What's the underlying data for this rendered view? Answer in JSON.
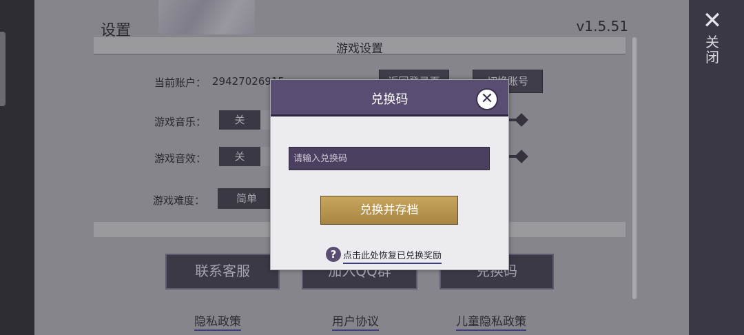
{
  "settings": {
    "title": "设置",
    "version": "v1.5.51",
    "section_title": "游戏设置",
    "account_label": "当前账户：",
    "account_value": "29427026915",
    "return_button": "返回登录页",
    "switch_account_button": "切换账号",
    "music_label": "游戏音乐：",
    "music_off": "关",
    "sound_label": "游戏音效：",
    "sound_off": "关",
    "difficulty_label": "游戏难度：",
    "difficulty_easy": "简单",
    "contact_button": "联系客服",
    "qq_button": "加入QQ群",
    "redeem_button": "兑换码",
    "privacy_link": "隐私政策",
    "agreement_link": "用户协议",
    "child_privacy_link": "儿童隐私政策"
  },
  "side": {
    "close_icon": "✕",
    "close_label": "关闭"
  },
  "dialog": {
    "title": "兑换码",
    "close_icon": "✕",
    "input_placeholder": "请输入兑换码",
    "input_value": "",
    "submit_button": "兑换并存档",
    "help_icon": "?",
    "restore_link": "点击此处恢复已兑换奖励"
  }
}
